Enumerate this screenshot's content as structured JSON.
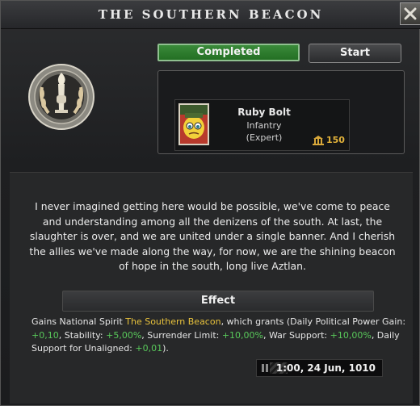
{
  "window": {
    "title": "The Southern Beacon"
  },
  "status_button": {
    "label": "Completed",
    "color": "#2f7f2f"
  },
  "start_button": {
    "label": "Start"
  },
  "reward": {
    "leader_name": "Ruby Bolt",
    "leader_type": "Infantry",
    "leader_rank": "(Expert)",
    "cost": "150",
    "cost_icon": "command-power-icon"
  },
  "emblem_icon": "torch-laurel-emblem-icon",
  "description": "I never imagined getting here would be possible, we've come to peace and understanding among all the denizens of the south. At last, the slaughter is over, and we are united under a single banner. And I cherish the allies we've made along the way, for now, we are the shining beacon of hope in the south, long live Aztlan.",
  "effect": {
    "header": "Effect",
    "prefix": "Gains National Spirit ",
    "spirit_name": "The Southern Beacon",
    "grants_open": ", which grants (Daily Political Power Gain: ",
    "pp_value": "+0,10",
    "stab_label": ", Stability: ",
    "stab_value": "+5,00%",
    "surr_label": ", Surrender Limit: ",
    "surr_value": "+10,00%",
    "war_label": ", War Support: ",
    "war_value": "+10,00%",
    "daily_label": ", Daily Support for Unaligned: ",
    "daily_value": "+0,01",
    "suffix": ").",
    "positive_color": "#58c85a",
    "spirit_color": "#e8c23c"
  },
  "date": {
    "text": "1:00, 24 Jun, 1010",
    "pause_icon": "pause-icon"
  },
  "close_icon": "close-icon"
}
